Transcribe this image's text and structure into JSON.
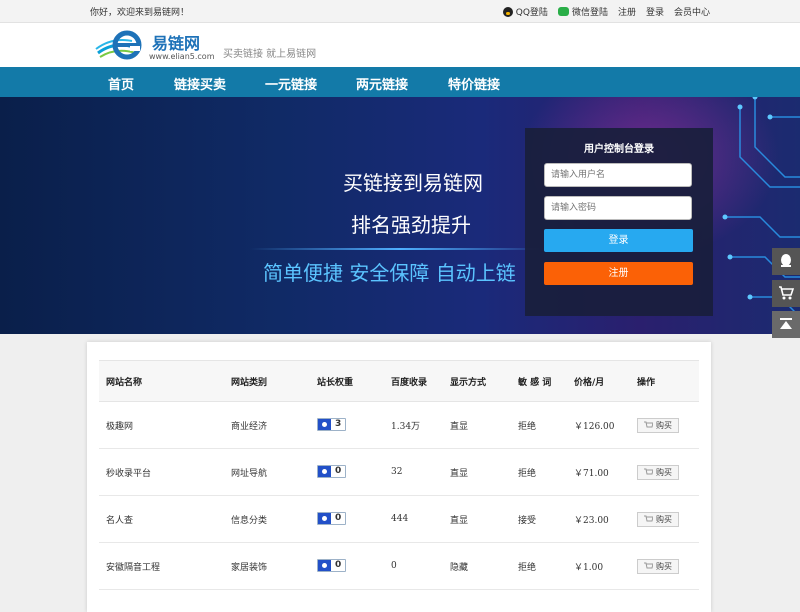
{
  "topbar": {
    "greeting": "你好，欢迎来到易链网！",
    "qq_login": "QQ登陆",
    "wechat_login": "微信登陆",
    "register": "注册",
    "login": "登录",
    "member_center": "会员中心"
  },
  "header": {
    "brand": "易链网",
    "domain": "www.elian5.com",
    "slogan": "买卖链接 就上易链网"
  },
  "nav": {
    "items": [
      "首页",
      "链接买卖",
      "一元链接",
      "两元链接",
      "特价链接"
    ]
  },
  "banner": {
    "line1": "买链接到易链网",
    "line2": "排名强劲提升",
    "line3": "简单便捷   安全保障   自动上链"
  },
  "login_box": {
    "title": "用户控制台登录",
    "username_placeholder": "请输入用户名",
    "password_placeholder": "请输入密码",
    "login_button": "登录",
    "register_button": "注册"
  },
  "table": {
    "headers": [
      "网站名称",
      "网站类别",
      "站长权重",
      "百度收录",
      "显示方式",
      "敏 感 词",
      "价格/月",
      "操作"
    ],
    "buy_label": "购买",
    "rows": [
      {
        "name": "极趣网",
        "category": "商业经济",
        "weight": "3",
        "indexed": "1.34万",
        "display": "直显",
        "sensitive": "拒绝",
        "price": "￥126.00"
      },
      {
        "name": "秒收录平台",
        "category": "网址导航",
        "weight": "0",
        "indexed": "32",
        "display": "直显",
        "sensitive": "拒绝",
        "price": "￥71.00"
      },
      {
        "name": "名人查",
        "category": "信息分类",
        "weight": "0",
        "indexed": "444",
        "display": "直显",
        "sensitive": "接受",
        "price": "￥23.00"
      },
      {
        "name": "安徽隔音工程",
        "category": "家居装饰",
        "weight": "0",
        "indexed": "0",
        "display": "隐藏",
        "sensitive": "拒绝",
        "price": "￥1.00"
      }
    ]
  },
  "colors": {
    "nav_bg": "#137aa8",
    "login_button": "#27a9f0",
    "register_button": "#fb6106"
  }
}
